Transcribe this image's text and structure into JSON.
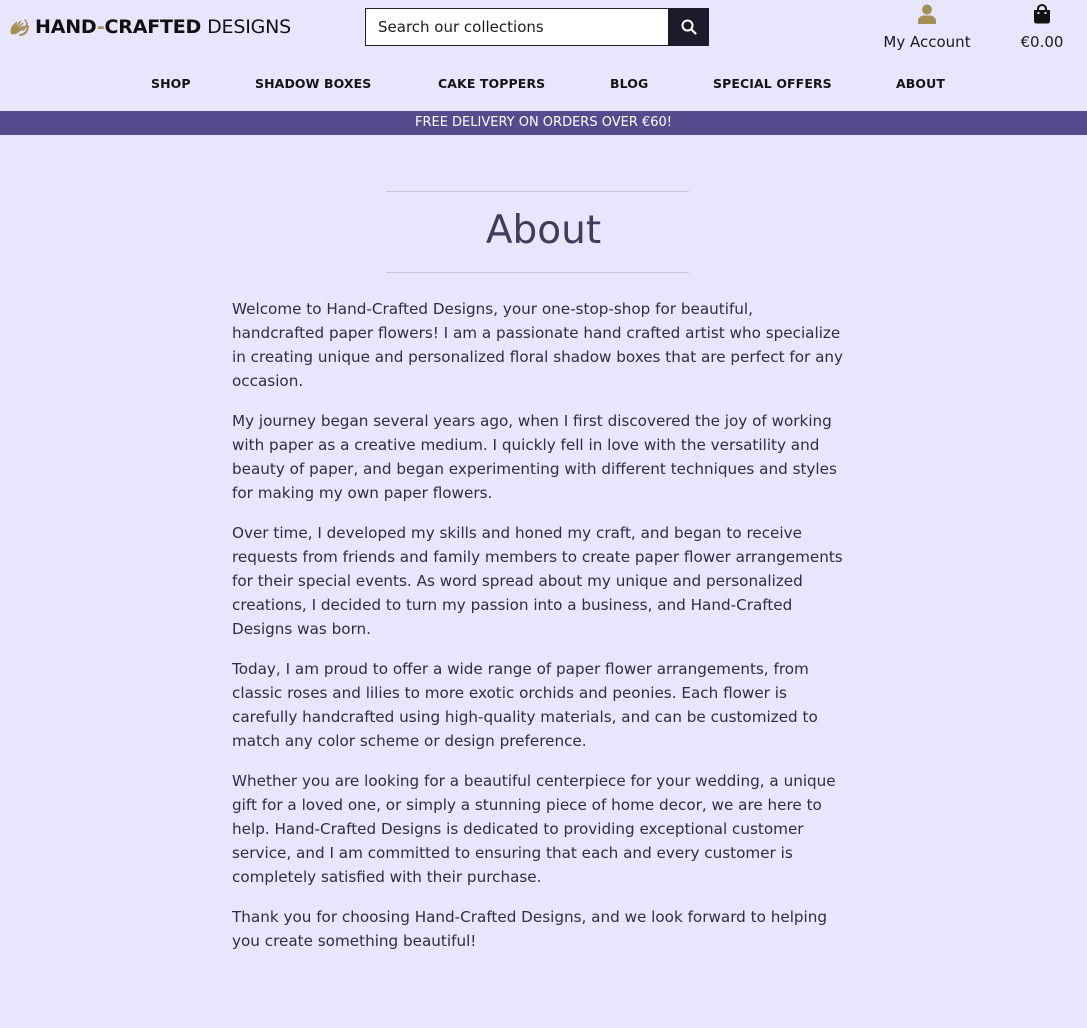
{
  "header": {
    "logo": {
      "icon": "hands-icon",
      "part1": "HAND",
      "hyphen": "-",
      "part2": "CRAFTED",
      "part3": "DESIGNS"
    },
    "search": {
      "placeholder": "Search our collections",
      "icon": "search-icon"
    },
    "account": {
      "icon": "user-icon",
      "label": "My Account"
    },
    "cart": {
      "icon": "shopping-bag-icon",
      "total": "€0.00"
    },
    "nav": [
      "SHOP",
      "SHADOW BOXES",
      "CAKE TOPPERS",
      "BLOG",
      "SPECIAL OFFERS",
      "ABOUT"
    ]
  },
  "promo": {
    "text": "FREE DELIVERY ON ORDERS OVER €60!"
  },
  "main": {
    "title": "About",
    "paragraphs": [
      "Welcome to Hand-Crafted Designs, your one-stop-shop for beautiful, handcrafted paper flowers! I am a passionate hand crafted artist who specialize in creating unique and personalized floral shadow boxes that are perfect for any occasion.",
      "My journey began several years ago, when I first discovered the joy of working with paper as a creative medium. I quickly fell in love with the versatility and beauty of paper, and began experimenting with different techniques and styles for making my own paper flowers.",
      "Over time, I developed my skills and honed my craft, and began to receive requests from friends and family members to create paper flower arrangements for their special events. As word spread about my unique and personalized creations, I decided to turn my passion into a business, and Hand-Crafted Designs was born.",
      "Today, I am proud to offer a wide range of paper flower arrangements, from classic roses and lilies to more exotic orchids and peonies. Each flower is carefully handcrafted using high-quality materials, and can be customized to match any color scheme or design preference.",
      "Whether you are looking for a beautiful centerpiece for your wedding, a unique gift for a loved one, or simply a stunning piece of home decor, we are here to help. Hand-Crafted Designs is dedicated to providing exceptional customer service, and I am committed to ensuring that each and every customer is completely satisfied with their purchase.",
      "Thank you for choosing Hand-Crafted Designs, and we look forward to helping you create something beautiful!"
    ]
  },
  "colors": {
    "background": "#e8e6fd",
    "promo_bar": "#554b8e",
    "accent_gold": "#a48f54",
    "search_button": "#1b1b2b",
    "title": "#413c5b"
  }
}
